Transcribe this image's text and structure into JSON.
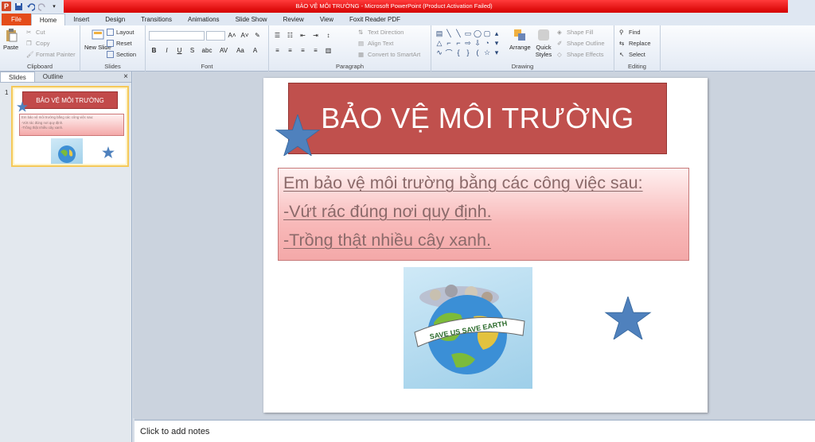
{
  "window": {
    "title": "BẢO VỆ MÔI TRƯỜNG  -  Microsoft PowerPoint (Product Activation Failed)",
    "app_icon": "P"
  },
  "ribbon_tabs": [
    "File",
    "Home",
    "Insert",
    "Design",
    "Transitions",
    "Animations",
    "Slide Show",
    "Review",
    "View",
    "Foxit Reader PDF"
  ],
  "ribbon": {
    "clipboard": {
      "label": "Clipboard",
      "paste": "Paste",
      "cut": "Cut",
      "copy": "Copy",
      "format_painter": "Format Painter"
    },
    "slides": {
      "label": "Slides",
      "new_slide": "New Slide",
      "layout": "Layout",
      "reset": "Reset",
      "section": "Section"
    },
    "font": {
      "label": "Font",
      "bold": "B",
      "italic": "I",
      "underline": "U",
      "strike": "S",
      "shadow": "abc",
      "spacing": "AV",
      "case": "Aa",
      "color": "A"
    },
    "paragraph": {
      "label": "Paragraph",
      "text_direction": "Text Direction",
      "align_text": "Align Text",
      "convert_smartart": "Convert to SmartArt"
    },
    "drawing": {
      "label": "Drawing",
      "arrange": "Arrange",
      "quick_styles": "Quick Styles",
      "shape_fill": "Shape Fill",
      "shape_outline": "Shape Outline",
      "shape_effects": "Shape Effects"
    },
    "editing": {
      "label": "Editing",
      "find": "Find",
      "replace": "Replace",
      "select": "Select"
    }
  },
  "panel": {
    "tabs": [
      "Slides",
      "Outline"
    ],
    "close": "×",
    "slide_number": "1"
  },
  "slide": {
    "title": "BẢO VỆ MÔI TRƯỜNG",
    "lines": [
      "Em bảo vệ môi trường bằng các công việc sau:",
      "-Vứt rác đúng nơi quy định.",
      "-Trồng thật nhiều cây xanh."
    ],
    "image_banner": "SAVE US SAVE EARTH"
  },
  "notes": {
    "placeholder": "Click to add notes"
  },
  "colors": {
    "title_fill": "#c0504d",
    "box_fill": "#f8b9b9",
    "star": "#4f81bd",
    "file_tab": "#e44c1a",
    "titlebar": "#e60000"
  }
}
